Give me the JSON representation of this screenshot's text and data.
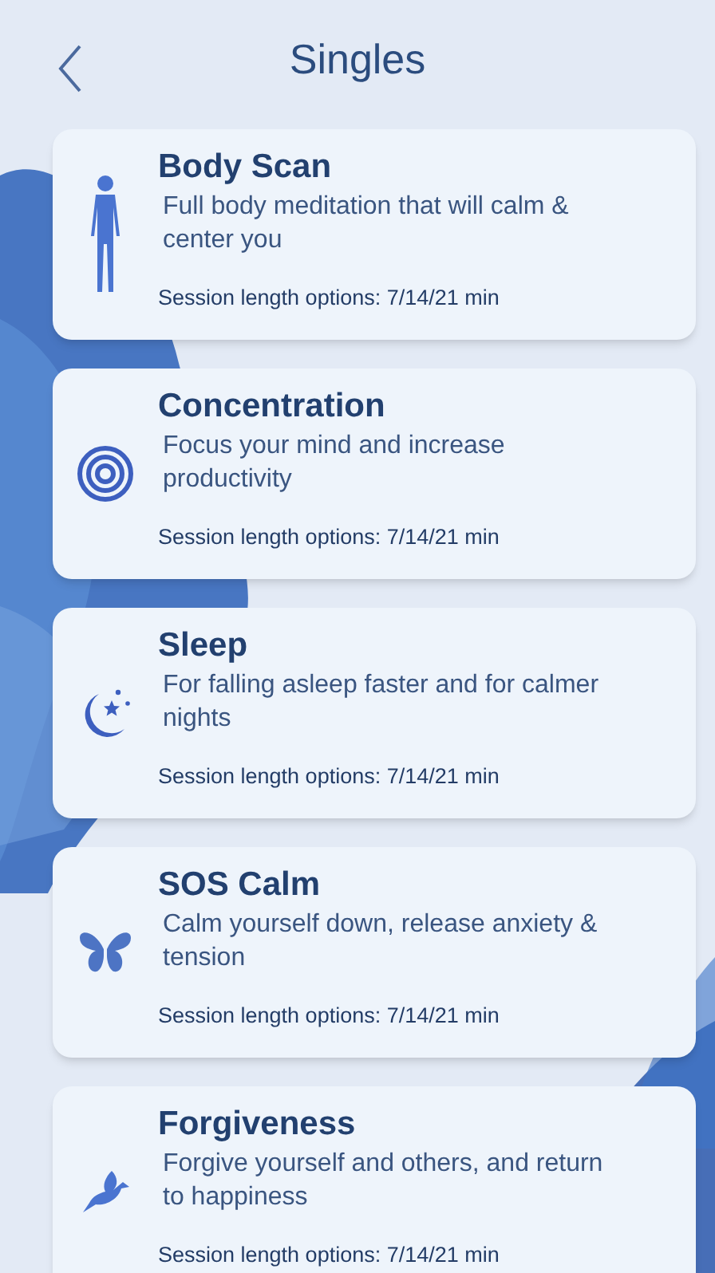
{
  "header": {
    "title": "Singles"
  },
  "sessions": [
    {
      "kind": "body",
      "title": "Body Scan",
      "description": "Full body meditation that will calm & center you",
      "options": "Session length options: 7/14/21 min"
    },
    {
      "kind": "target",
      "title": "Concentration",
      "description": "Focus your mind and increase productivity",
      "options": "Session length options: 7/14/21 min"
    },
    {
      "kind": "moon",
      "title": "Sleep",
      "description": "For falling asleep faster and for calmer nights",
      "options": "Session length options: 7/14/21 min"
    },
    {
      "kind": "butterfly",
      "title": "SOS Calm",
      "description": "Calm yourself down, release anxiety & tension",
      "options": "Session length options: 7/14/21 min"
    },
    {
      "kind": "bird",
      "title": "Forgiveness",
      "description": "Forgive yourself and others, and return to happiness",
      "options": "Session length options: 7/14/21 min"
    }
  ]
}
